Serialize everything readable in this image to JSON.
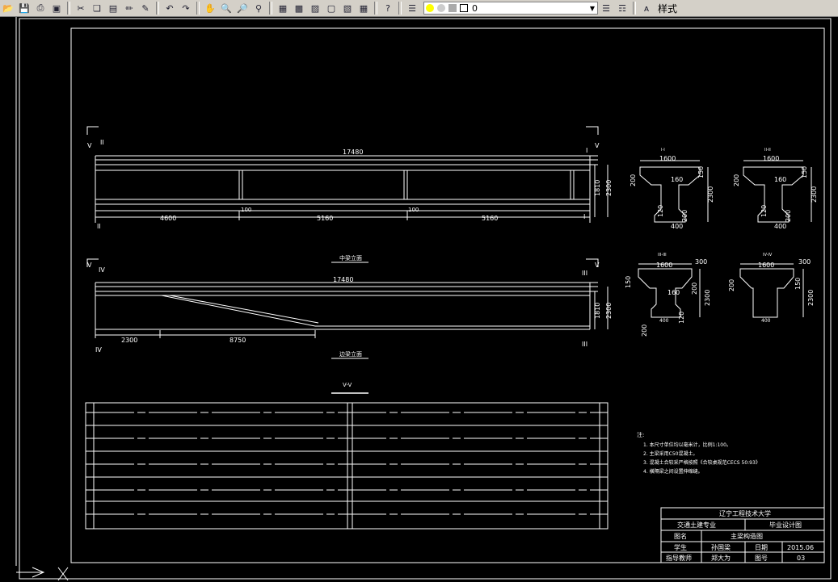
{
  "toolbar": {
    "buttons": [
      "open-icon",
      "save-icon",
      "print-icon",
      "plot-preview-icon",
      "publish-icon",
      "cut-icon",
      "copy-icon",
      "paste-icon",
      "match-properties-icon",
      "block-editor-icon",
      "undo-icon",
      "redo-icon",
      "pan-icon",
      "zoom-realtime-icon",
      "zoom-window-icon",
      "zoom-previous-icon",
      "properties-icon",
      "design-center-icon",
      "tool-palettes-icon",
      "sheet-set-icon",
      "markup-icon",
      "calculator-icon",
      "help-icon",
      "layer-manager-icon"
    ],
    "layer_value": "0",
    "style_label": "样式"
  },
  "drawing": {
    "elev1": {
      "dim_total": "17480",
      "dim_height1": "1810",
      "dim_height2": "2300",
      "dim_segments": [
        "4600",
        "5160",
        "5160"
      ],
      "dim_small": [
        "100",
        "100"
      ],
      "markers": [
        "V",
        "II",
        "I",
        "V",
        "II",
        "I"
      ],
      "caption": "中梁立面"
    },
    "elev2": {
      "dim_total": "17480",
      "dim_height1": "1810",
      "dim_height2": "2300",
      "dim_segments": [
        "2300",
        "8750"
      ],
      "markers": [
        "V",
        "IV",
        "III",
        "V",
        "IV",
        "III"
      ],
      "caption": "边梁立面"
    },
    "sections": [
      {
        "title": "I-I",
        "dims": [
          "1600",
          "200",
          "160",
          "150",
          "2300",
          "120",
          "200",
          "400"
        ]
      },
      {
        "title": "II-II",
        "dims": [
          "1600",
          "200",
          "160",
          "150",
          "2300",
          "120",
          "200",
          "400"
        ]
      },
      {
        "title": "III-III",
        "dims": [
          "1600",
          "300",
          "150",
          "200",
          "160",
          "2300",
          "200",
          "400",
          "120"
        ]
      },
      {
        "title": "IV-IV",
        "dims": [
          "1600",
          "300",
          "200",
          "150",
          "2300",
          "400"
        ]
      }
    ],
    "plan_title": "V-V",
    "notes": {
      "heading": "注:",
      "items": [
        "1. 本尺寸单位均以毫米计，比例1:100。",
        "2. 主梁采用C50混凝土。",
        "3. 混凝土合较采严格按照《合较桌规范CECS 50:93》",
        "4. 横隔梁之间设置伸缩缝。"
      ]
    },
    "title_block": {
      "school": "辽宁工程技术大学",
      "major": "交通土建专业",
      "design_type": "毕业设计图",
      "name_label": "图名",
      "name_value": "主梁构造图",
      "student_label": "学生",
      "student_value": "孙国梁",
      "date_label": "日期",
      "date_value": "2015.06",
      "advisor_label": "指导教师",
      "advisor_value": "郑大为",
      "sheet_label": "图号",
      "sheet_value": "03"
    }
  },
  "colors": {
    "toolbar_bg": "#d4d0c8",
    "canvas_bg": "#000000",
    "line": "#ffffff"
  }
}
